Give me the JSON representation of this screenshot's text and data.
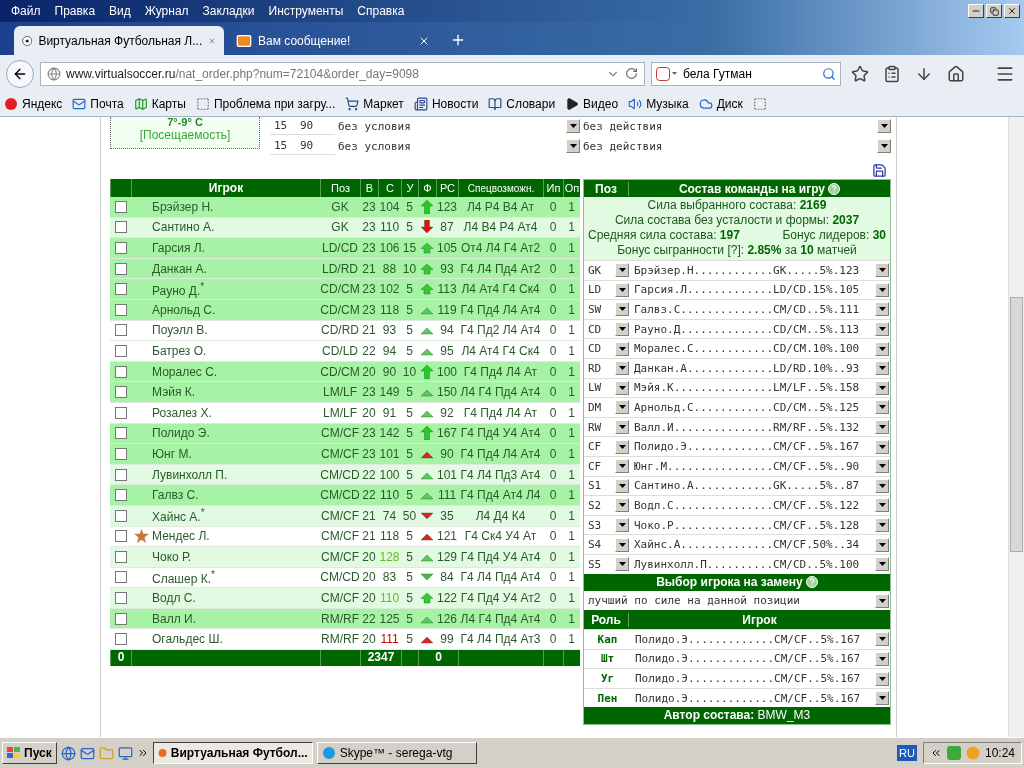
{
  "menu_bar": [
    "Файл",
    "Правка",
    "Вид",
    "Журнал",
    "Закладки",
    "Инструменты",
    "Справка"
  ],
  "tabs": [
    {
      "title": "Виртуальная Футбольная Л...",
      "selected": true
    },
    {
      "title": "Вам сообщение!",
      "selected": false
    }
  ],
  "address_bar": {
    "host": "www.virtualsoccer.ru",
    "path": "/nat_order.php?num=72104&order_day=9098"
  },
  "search_bar": {
    "value": "бела Гутман"
  },
  "bookmarks": [
    "Яндекс",
    "Почта",
    "Карты",
    "Проблема при загру...",
    "Маркет",
    "Новости",
    "Словари",
    "Видео",
    "Музыка",
    "Диск"
  ],
  "conditions": {
    "temperature": "7°-9° C",
    "attendance_link": "[Посещаемость]",
    "rows": [
      {
        "minute_from": "15",
        "minute_to": "90",
        "condition": "без условия",
        "action": "без действия"
      },
      {
        "minute_from": "15",
        "minute_to": "90",
        "condition": "без условия",
        "action": "без действия"
      }
    ]
  },
  "players_table": {
    "columns": [
      "Игрок",
      "Поз",
      "В",
      "С",
      "У",
      "Ф",
      "РС",
      "Спецвозможн.",
      "Ип",
      "Оп"
    ],
    "rows": [
      {
        "name": "Брэйзер Н.",
        "pos": "GK",
        "age": "23",
        "strength": {
          "value": "104",
          "color": "#2a5a2a"
        },
        "fatigue": "5",
        "form": {
          "kind": "big-up"
        },
        "real_strength": "123",
        "abilities": "Л4 Р4 В4 Ат",
        "ip": "0",
        "op": "1",
        "checked": false,
        "kind": "starter",
        "leader": false
      },
      {
        "name": "Сантино А.",
        "pos": "GK",
        "age": "23",
        "strength": {
          "value": "110",
          "color": "#2a5a2a"
        },
        "fatigue": "5",
        "form": {
          "kind": "big-down-red"
        },
        "real_strength": "87",
        "abilities": "Л4 В4 Р4 Ат4",
        "ip": "0",
        "op": "1",
        "checked": false,
        "kind": "sub",
        "leader": false
      },
      {
        "name": "Гарсия Л.",
        "pos": "LD/CD",
        "age": "23",
        "strength": {
          "value": "106",
          "color": "#2a5a2a"
        },
        "fatigue": "15",
        "form": {
          "kind": "mid-up"
        },
        "real_strength": "105",
        "abilities": "От4 Л4 Г4 Ат2",
        "ip": "0",
        "op": "1",
        "checked": false,
        "kind": "starter",
        "leader": false
      },
      {
        "name": "Данкан А.",
        "pos": "LD/RD",
        "age": "21",
        "strength": {
          "value": "88",
          "color": "#2a5a2a"
        },
        "fatigue": "10",
        "form": {
          "kind": "mid-up"
        },
        "real_strength": "93",
        "abilities": "Г4 Л4 Пд4 Ат2",
        "ip": "0",
        "op": "1",
        "checked": false,
        "kind": "starter",
        "leader": false
      },
      {
        "name": "Рауно Д.$^{*}$",
        "pos": "CD/CM",
        "age": "23",
        "strength": {
          "value": "102",
          "color": "#2a5a2a"
        },
        "fatigue": "5",
        "form": {
          "kind": "mid-up"
        },
        "real_strength": "113",
        "abilities": "Л4 Ат4 Г4 Ск4",
        "ip": "0",
        "op": "1",
        "checked": false,
        "kind": "starter",
        "leader": false
      },
      {
        "name": "Арнольд С.",
        "pos": "CD/CM",
        "age": "23",
        "strength": {
          "value": "118",
          "color": "#2a5a2a"
        },
        "fatigue": "5",
        "form": {
          "kind": "tri-up"
        },
        "real_strength": "119",
        "abilities": "Г4 Пд4 Л4 Ат4",
        "ip": "0",
        "op": "1",
        "checked": false,
        "kind": "starter",
        "leader": false
      },
      {
        "name": "Поуэлл В.",
        "pos": "CD/RD",
        "age": "21",
        "strength": {
          "value": "93",
          "color": "#2a5a2a"
        },
        "fatigue": "5",
        "form": {
          "kind": "tri-up"
        },
        "real_strength": "94",
        "abilities": "Г4 Пд2 Л4 Ат4",
        "ip": "0",
        "op": "1",
        "checked": false,
        "kind": "reserve",
        "leader": false
      },
      {
        "name": "Батрез О.",
        "pos": "CD/LD",
        "age": "22",
        "strength": {
          "value": "94",
          "color": "#2a5a2a"
        },
        "fatigue": "5",
        "form": {
          "kind": "tri-up"
        },
        "real_strength": "95",
        "abilities": "Л4 Ат4 Г4 Ск4",
        "ip": "0",
        "op": "1",
        "checked": false,
        "kind": "reserve",
        "leader": false
      },
      {
        "name": "Моралес С.",
        "pos": "CD/CM",
        "age": "20",
        "strength": {
          "value": "90",
          "color": "#2a5a2a"
        },
        "fatigue": "10",
        "form": {
          "kind": "big-up"
        },
        "real_strength": "100",
        "abilities": "Г4 Пд4 Л4 Ат",
        "ip": "0",
        "op": "1",
        "checked": false,
        "kind": "starter",
        "leader": false
      },
      {
        "name": "Мэйя К.",
        "pos": "LM/LF",
        "age": "23",
        "strength": {
          "value": "149",
          "color": "#2a5a2a"
        },
        "fatigue": "5",
        "form": {
          "kind": "tri-up"
        },
        "real_strength": "150",
        "abilities": "Л4 Г4 Пд4 Ат4",
        "ip": "0",
        "op": "1",
        "checked": false,
        "kind": "starter",
        "leader": false
      },
      {
        "name": "Розалез Х.",
        "pos": "LM/LF",
        "age": "20",
        "strength": {
          "value": "91",
          "color": "#2a5a2a"
        },
        "fatigue": "5",
        "form": {
          "kind": "tri-up"
        },
        "real_strength": "92",
        "abilities": "Г4 Пд4 Л4 Ат",
        "ip": "0",
        "op": "1",
        "checked": false,
        "kind": "reserve",
        "leader": false
      },
      {
        "name": "Полидо Э.",
        "pos": "CM/CF",
        "age": "23",
        "strength": {
          "value": "142",
          "color": "#2a5a2a"
        },
        "fatigue": "5",
        "form": {
          "kind": "big-up"
        },
        "real_strength": "167",
        "abilities": "Г4 Пд4 У4 Ат4",
        "ip": "0",
        "op": "1",
        "checked": false,
        "kind": "starter",
        "leader": false
      },
      {
        "name": "Юнг М.",
        "pos": "CM/CF",
        "age": "23",
        "strength": {
          "value": "101",
          "color": "#2a5a2a"
        },
        "fatigue": "5",
        "form": {
          "kind": "tri-up-red"
        },
        "real_strength": "90",
        "abilities": "Г4 Пд4 Л4 Ат4",
        "ip": "0",
        "op": "1",
        "checked": false,
        "kind": "starter",
        "leader": false
      },
      {
        "name": "Лувинхолл П.",
        "pos": "CM/CD",
        "age": "22",
        "strength": {
          "value": "100",
          "color": "#2a5a2a"
        },
        "fatigue": "5",
        "form": {
          "kind": "tri-up"
        },
        "real_strength": "101",
        "abilities": "Г4 Л4 Пд3 Ат4",
        "ip": "0",
        "op": "1",
        "checked": false,
        "kind": "sub",
        "leader": false
      },
      {
        "name": "Галвз С.",
        "pos": "CM/CD",
        "age": "22",
        "strength": {
          "value": "110",
          "color": "#2a5a2a"
        },
        "fatigue": "5",
        "form": {
          "kind": "tri-up"
        },
        "real_strength": "111",
        "abilities": "Г4 Пд4 Ат4 Л4",
        "ip": "0",
        "op": "1",
        "checked": false,
        "kind": "starter",
        "leader": false
      },
      {
        "name": "Хайнс А.$^{*}$",
        "pos": "CM/CF",
        "age": "21",
        "strength": {
          "value": "74",
          "color": "#2a5a2a"
        },
        "fatigue": "50",
        "form": {
          "kind": "tri-down-red"
        },
        "real_strength": "35",
        "abilities": "Л4 Д4 К4",
        "ip": "0",
        "op": "1",
        "checked": false,
        "kind": "sub",
        "leader": false
      },
      {
        "name": "Мендес Л.",
        "pos": "CM/CF",
        "age": "21",
        "strength": {
          "value": "118",
          "color": "#2a5a2a"
        },
        "fatigue": "5",
        "form": {
          "kind": "tri-up-red"
        },
        "real_strength": "121",
        "abilities": "Г4 Ск4 У4 Ат",
        "ip": "0",
        "op": "1",
        "checked": false,
        "kind": "reserve",
        "leader": true
      },
      {
        "name": "Чоко Р.",
        "pos": "CM/CF",
        "age": "20",
        "strength": {
          "value": "128",
          "color": "#66bb22"
        },
        "fatigue": "5",
        "form": {
          "kind": "tri-up"
        },
        "real_strength": "129",
        "abilities": "Г4 Пд4 У4 Ат4",
        "ip": "0",
        "op": "1",
        "checked": false,
        "kind": "sub",
        "leader": false
      },
      {
        "name": "Слашер К.$^{*}$",
        "pos": "CM/CD",
        "age": "20",
        "strength": {
          "value": "83",
          "color": "#2a5a2a"
        },
        "fatigue": "5",
        "form": {
          "kind": "tri-down"
        },
        "real_strength": "84",
        "abilities": "Г4 Л4 Пд4 Ат4",
        "ip": "0",
        "op": "1",
        "checked": false,
        "kind": "reserve",
        "leader": false
      },
      {
        "name": "Водл С.",
        "pos": "CM/CF",
        "age": "20",
        "strength": {
          "value": "110",
          "color": "#66bb22"
        },
        "fatigue": "5",
        "form": {
          "kind": "mid-up"
        },
        "real_strength": "122",
        "abilities": "Г4 Пд4 У4 Ат2",
        "ip": "0",
        "op": "1",
        "checked": false,
        "kind": "sub",
        "leader": false
      },
      {
        "name": "Валл И.",
        "pos": "RM/RF",
        "age": "22",
        "strength": {
          "value": "125",
          "color": "#2a5a2a"
        },
        "fatigue": "5",
        "form": {
          "kind": "tri-up"
        },
        "real_strength": "126",
        "abilities": "Л4 Г4 Пд4 Ат4",
        "ip": "0",
        "op": "1",
        "checked": false,
        "kind": "starter",
        "leader": false
      },
      {
        "name": "Огальдес Ш.",
        "pos": "RM/RF",
        "age": "20",
        "strength": {
          "value": "111",
          "color": "#cc0000"
        },
        "fatigue": "5",
        "form": {
          "kind": "tri-up-red"
        },
        "real_strength": "99",
        "abilities": "Г4 Л4 Пд4 Ат3",
        "ip": "0",
        "op": "1",
        "checked": false,
        "kind": "reserve",
        "leader": false
      }
    ],
    "totals": {
      "selected_count": "0",
      "strength": "2347",
      "form": "0"
    }
  },
  "lineup": {
    "pos_header": "Поз",
    "title": "Состав команды на игру",
    "stats": [
      "Сила выбранного состава: **2169**",
      "Сила состава без усталости и формы: **2037**"
    ],
    "average": "Средняя сила состава: **197**",
    "leaders_bonus": "Бонус лидеров: **30**",
    "teamwork": "Бонус сыгранности [?]: **2.85%** за **10** матчей",
    "rows": [
      {
        "pos": "GK",
        "player": "Брэйзер.Н............GK.....5%.123"
      },
      {
        "pos": "LD",
        "player": "Гарсия.Л.............LD/CD.15%.105"
      },
      {
        "pos": "SW",
        "player": "Галвз.С..............CM/CD..5%.111"
      },
      {
        "pos": "CD",
        "player": "Рауно.Д..............CD/CM..5%.113"
      },
      {
        "pos": "CD",
        "player": "Моралес.С............CD/CM.10%.100"
      },
      {
        "pos": "RD",
        "player": "Данкан.А.............LD/RD.10%..93"
      },
      {
        "pos": "LW",
        "player": "Мэйя.К...............LM/LF..5%.158"
      },
      {
        "pos": "DM",
        "player": "Арнольд.С............CD/CM..5%.125"
      },
      {
        "pos": "RW",
        "player": "Валл.И...............RM/RF..5%.132"
      },
      {
        "pos": "CF",
        "player": "Полидо.Э.............CM/CF..5%.167"
      },
      {
        "pos": "CF",
        "player": "Юнг.М................CM/CF..5%..90"
      },
      {
        "pos": "S1",
        "player": "Сантино.А............GK.....5%..87"
      },
      {
        "pos": "S2",
        "player": "Водл.С...............CM/CF..5%.122"
      },
      {
        "pos": "S3",
        "player": "Чоко.Р...............CM/CF..5%.128"
      },
      {
        "pos": "S4",
        "player": "Хайнс.А..............CM/CF.50%..34"
      },
      {
        "pos": "S5",
        "player": "Лувинхолл.П..........CM/CD..5%.100"
      }
    ],
    "substitution_title": "Выбор игрока на замену",
    "substitution_rule": "лучший по силе на данной позиции",
    "roles_columns": [
      "Роль",
      "Игрок"
    ],
    "roles": [
      {
        "role": "Кап",
        "player": "Полидо.Э.............CM/CF..5%.167"
      },
      {
        "role": "Шт",
        "player": "Полидо.Э.............CM/CF..5%.167"
      },
      {
        "role": "Уг",
        "player": "Полидо.Э.............CM/CF..5%.167"
      },
      {
        "role": "Пен",
        "player": "Полидо.Э.............CM/CF..5%.167"
      }
    ],
    "author": "**Автор состава:** BMW_M3"
  },
  "taskbar": {
    "start": "Пуск",
    "tasks": [
      {
        "title": "Виртуальная Футбол...",
        "selected": true
      },
      {
        "title": "Skype™ - serega-vtg",
        "selected": false
      }
    ],
    "language": "RU",
    "time": "10:24"
  }
}
